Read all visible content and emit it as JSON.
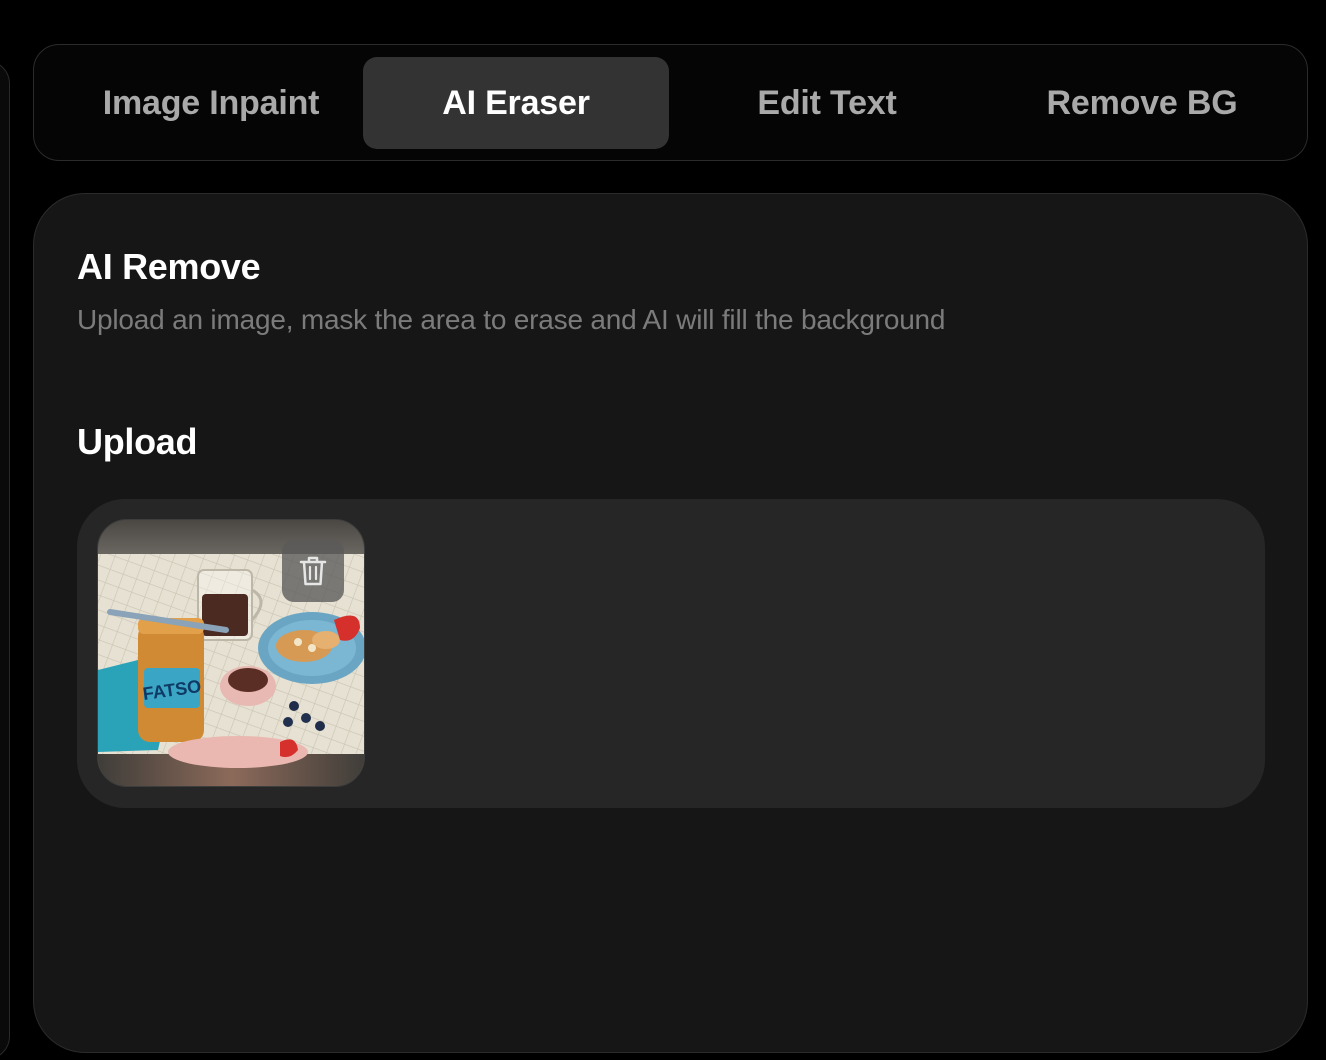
{
  "tabs": [
    {
      "label": "Image Inpaint",
      "active": false
    },
    {
      "label": "AI Eraser",
      "active": true
    },
    {
      "label": "Edit Text",
      "active": false
    },
    {
      "label": "Remove BG",
      "active": false
    }
  ],
  "panel": {
    "title": "AI Remove",
    "description": "Upload an image, mask the area to erase and AI will fill the background"
  },
  "upload": {
    "label": "Upload",
    "thumbnail": {
      "jar_label": "FATSO",
      "delete_icon": "trash-icon"
    }
  },
  "colors": {
    "background": "#000000",
    "panel": "#161616",
    "active_tab": "#333333",
    "dropzone": "#262626",
    "muted_text": "#7b7b7b"
  }
}
